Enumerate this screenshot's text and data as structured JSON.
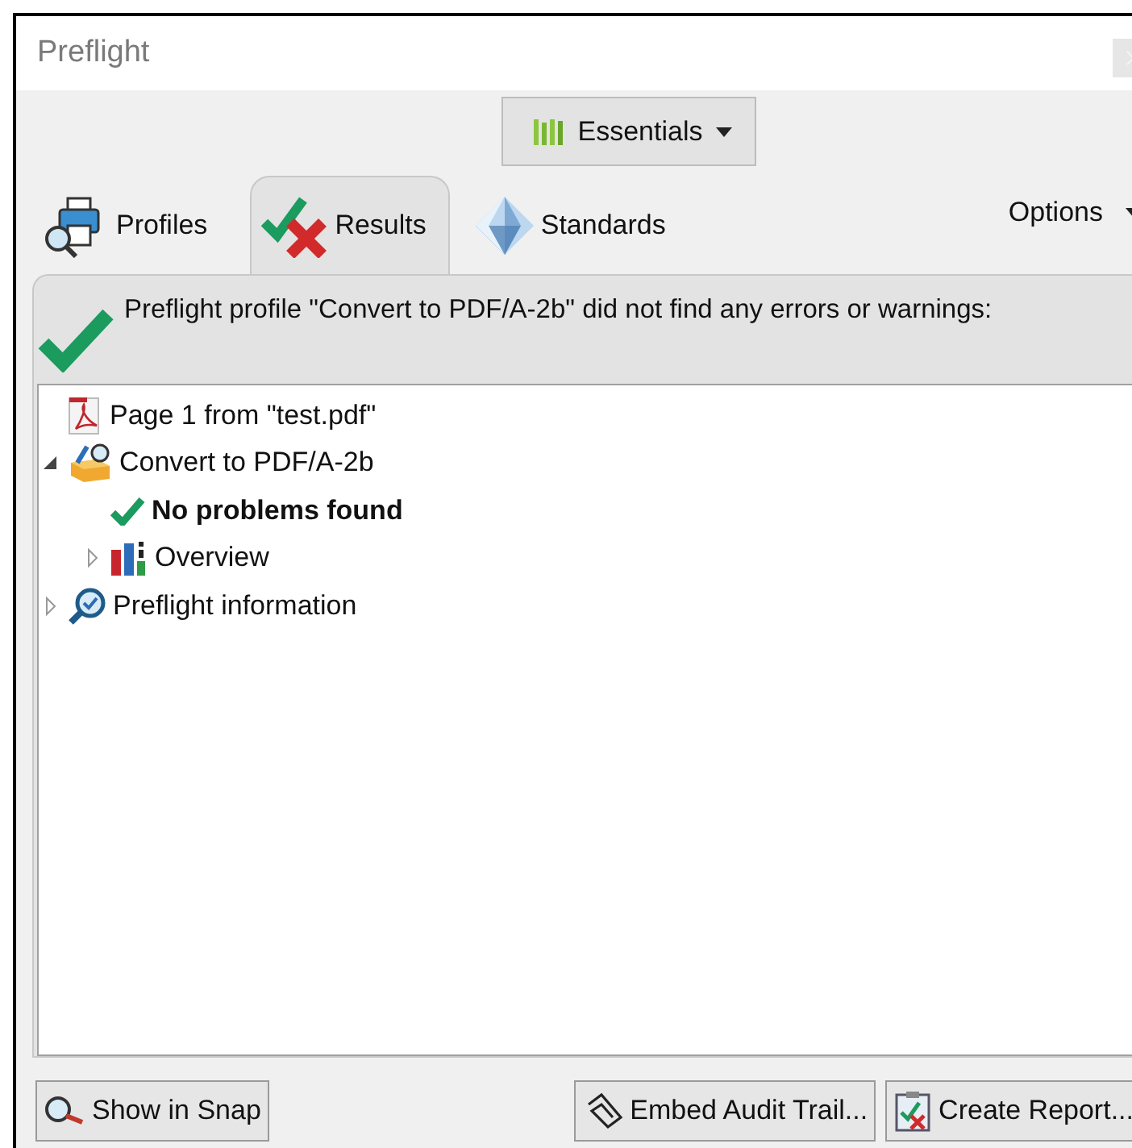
{
  "window": {
    "title": "Preflight"
  },
  "workspace_button": {
    "label": "Essentials"
  },
  "tabs": [
    {
      "label": "Profiles",
      "selected": false
    },
    {
      "label": "Results",
      "selected": true
    },
    {
      "label": "Standards",
      "selected": false
    }
  ],
  "options": {
    "label": "Options"
  },
  "message": "Preflight profile \"Convert to PDF/A-2b\" did not find any errors or warnings:",
  "tree": [
    {
      "label": "Page 1 from \"test.pdf\""
    },
    {
      "label": "Convert to PDF/A-2b",
      "expanded": true,
      "children": [
        {
          "label": "No problems found",
          "bold": true
        },
        {
          "label": "Overview",
          "expanded": false
        }
      ]
    },
    {
      "label": "Preflight information",
      "expanded": false
    }
  ],
  "buttons": [
    {
      "label": "Show in Snap"
    },
    {
      "label": "Embed Audit Trail..."
    },
    {
      "label": "Create Report..."
    }
  ]
}
